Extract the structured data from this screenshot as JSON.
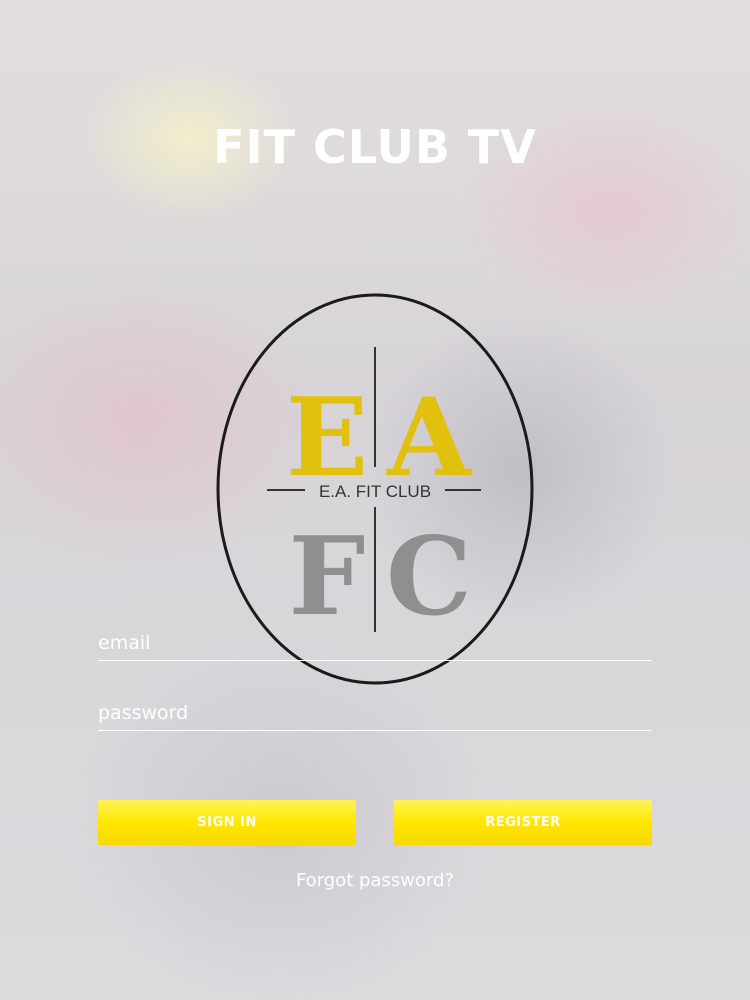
{
  "app_title": "FIT CLUB TV",
  "logo": {
    "top_left": "E",
    "top_right": "A",
    "bottom_left": "F",
    "bottom_right": "C",
    "banner": "E.A. FIT CLUB",
    "colors": {
      "gold": "#e2c10e",
      "gray": "#8f8f8f",
      "ring": "#1b1b1b"
    }
  },
  "form": {
    "email_placeholder": "email",
    "email_value": "",
    "password_placeholder": "password",
    "password_value": ""
  },
  "buttons": {
    "sign_in": "SIGN IN",
    "register": "REGISTER"
  },
  "forgot_password": "Forgot password?",
  "colors": {
    "button_yellow": "#ffe600",
    "text": "#ffffff"
  }
}
